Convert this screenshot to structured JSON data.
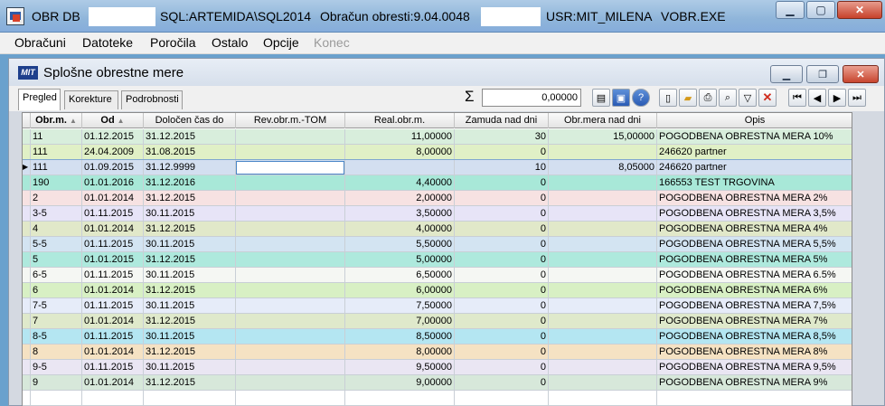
{
  "window": {
    "title_prefix": "OBR   DB",
    "title_db": "SQL:ARTEMIDA\\SQL2014",
    "title_obracun": "Obračun obresti:9.04.0048",
    "title_user": "USR:MIT_MILENA",
    "title_exe": "VOBR.EXE"
  },
  "menu": [
    "Obračuni",
    "Datoteke",
    "Poročila",
    "Ostalo",
    "Opcije",
    "Konec"
  ],
  "inner": {
    "logo": "MIT",
    "title": "Splošne obrestne mere"
  },
  "tabs": [
    "Pregled",
    "Korekture",
    "Podrobnosti"
  ],
  "sum": {
    "symbol": "Σ",
    "value": "0,00000"
  },
  "columns": [
    "Obr.m.",
    "Od",
    "Določen čas do",
    "Rev.obr.m.-TOM",
    "Real.obr.m.",
    "Zamuda nad dni",
    "Obr.mera nad dni",
    "Opis"
  ],
  "rows": [
    {
      "c": [
        "11",
        "01.12.2015",
        "31.12.2015",
        "",
        "11,00000",
        "30",
        "15,00000",
        "POGODBENA OBRESTNA MERA 10%"
      ],
      "bg": "#d8eedc"
    },
    {
      "c": [
        "111",
        "24.04.2009",
        "31.08.2015",
        "",
        "8,00000",
        "0",
        "",
        "246620 partner"
      ],
      "bg": "#e0f0c6"
    },
    {
      "c": [
        "111",
        "01.09.2015",
        "31.12.9999",
        "",
        "",
        "10",
        "8,05000",
        "246620 partner"
      ],
      "bg": "#d3dff0"
    },
    {
      "c": [
        "190",
        "01.01.2016",
        "31.12.2016",
        "",
        "4,40000",
        "0",
        "",
        "166553 TEST TRGOVINA"
      ],
      "bg": "#a8e8d8"
    },
    {
      "c": [
        "2",
        "01.01.2014",
        "31.12.2015",
        "",
        "2,00000",
        "0",
        "",
        "POGODBENA OBRESTNA MERA 2%"
      ],
      "bg": "#f7e2e2"
    },
    {
      "c": [
        "3-5",
        "01.11.2015",
        "30.11.2015",
        "",
        "3,50000",
        "0",
        "",
        "POGODBENA OBRESTNA MERA 3,5%"
      ],
      "bg": "#e7e4f7"
    },
    {
      "c": [
        "4",
        "01.01.2014",
        "31.12.2015",
        "",
        "4,00000",
        "0",
        "",
        "POGODBENA OBRESTNA MERA  4%"
      ],
      "bg": "#e1e8c9"
    },
    {
      "c": [
        "5-5",
        "01.11.2015",
        "30.11.2015",
        "",
        "5,50000",
        "0",
        "",
        "POGODBENA OBRESTNA MERA  5,5%"
      ],
      "bg": "#d3e4f2"
    },
    {
      "c": [
        "5",
        "01.01.2015",
        "31.12.2015",
        "",
        "5,00000",
        "0",
        "",
        "POGODBENA OBRESTNA MERA  5%"
      ],
      "bg": "#aee9dd"
    },
    {
      "c": [
        "6-5",
        "01.11.2015",
        "30.11.2015",
        "",
        "6,50000",
        "0",
        "",
        "POGODBENA OBRESTNA MERA  6.5%"
      ],
      "bg": "#f5f7f3"
    },
    {
      "c": [
        "6",
        "01.01.2014",
        "31.12.2015",
        "",
        "6,00000",
        "0",
        "",
        "POGODBENA OBRESTNA MERA  6%"
      ],
      "bg": "#d8f0c4"
    },
    {
      "c": [
        "7-5",
        "01.11.2015",
        "30.11.2015",
        "",
        "7,50000",
        "0",
        "",
        "POGODBENA OBRESTNA MERA  7,5%"
      ],
      "bg": "#e6ecf9"
    },
    {
      "c": [
        "7",
        "01.01.2014",
        "31.12.2015",
        "",
        "7,00000",
        "0",
        "",
        "POGODBENA OBRESTNA MERA  7%"
      ],
      "bg": "#dfe9cb"
    },
    {
      "c": [
        "8-5",
        "01.11.2015",
        "30.11.2015",
        "",
        "8,50000",
        "0",
        "",
        "POGODBENA OBRESTNA MERA 8,5%"
      ],
      "bg": "#b4e6f2"
    },
    {
      "c": [
        "8",
        "01.01.2014",
        "31.12.2015",
        "",
        "8,00000",
        "0",
        "",
        "POGODBENA OBRESTNA MERA  8%"
      ],
      "bg": "#f5e2c3"
    },
    {
      "c": [
        "9-5",
        "01.11.2015",
        "30.11.2015",
        "",
        "9,50000",
        "0",
        "",
        "POGODBENA OBRESTNA MERA 9,5%"
      ],
      "bg": "#eae6f3"
    },
    {
      "c": [
        "9",
        "01.01.2014",
        "31.12.2015",
        "",
        "9,00000",
        "0",
        "",
        "POGODBENA OBRESTNA MERA  9%"
      ],
      "bg": "#d7e8da"
    },
    {
      "c": [
        "",
        "",
        "",
        "",
        "",
        "",
        "",
        ""
      ],
      "bg": "#ffffff"
    }
  ],
  "selected_row": 2
}
